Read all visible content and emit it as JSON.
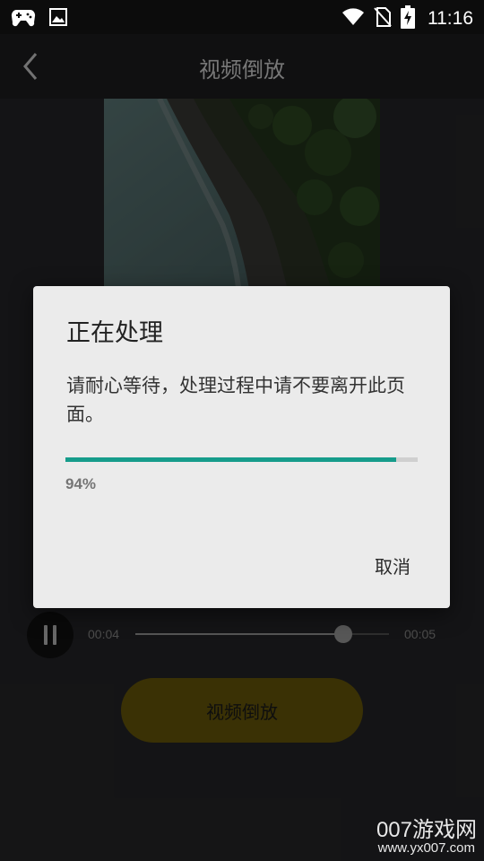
{
  "status_bar": {
    "time": "11:16",
    "icons": [
      "gamepad-icon",
      "image-icon",
      "wifi-icon",
      "no-sim-icon",
      "battery-charging-icon"
    ]
  },
  "app_bar": {
    "title": "视频倒放",
    "back_icon": "chevron-left-icon"
  },
  "player": {
    "current_time": "00:04",
    "total_time": "00:05",
    "progress": 0.82,
    "state_icon": "pause-icon"
  },
  "action_button": {
    "label": "视频倒放",
    "color": "#6a5a0a"
  },
  "dialog": {
    "title": "正在处理",
    "message": "请耐心等待，处理过程中请不要离开此页面。",
    "progress": 0.94,
    "progress_text": "94%",
    "accent_color": "#169c8b",
    "cancel_label": "取消"
  },
  "watermark": {
    "brand": "007游戏网",
    "url": "www.yx007.com"
  }
}
